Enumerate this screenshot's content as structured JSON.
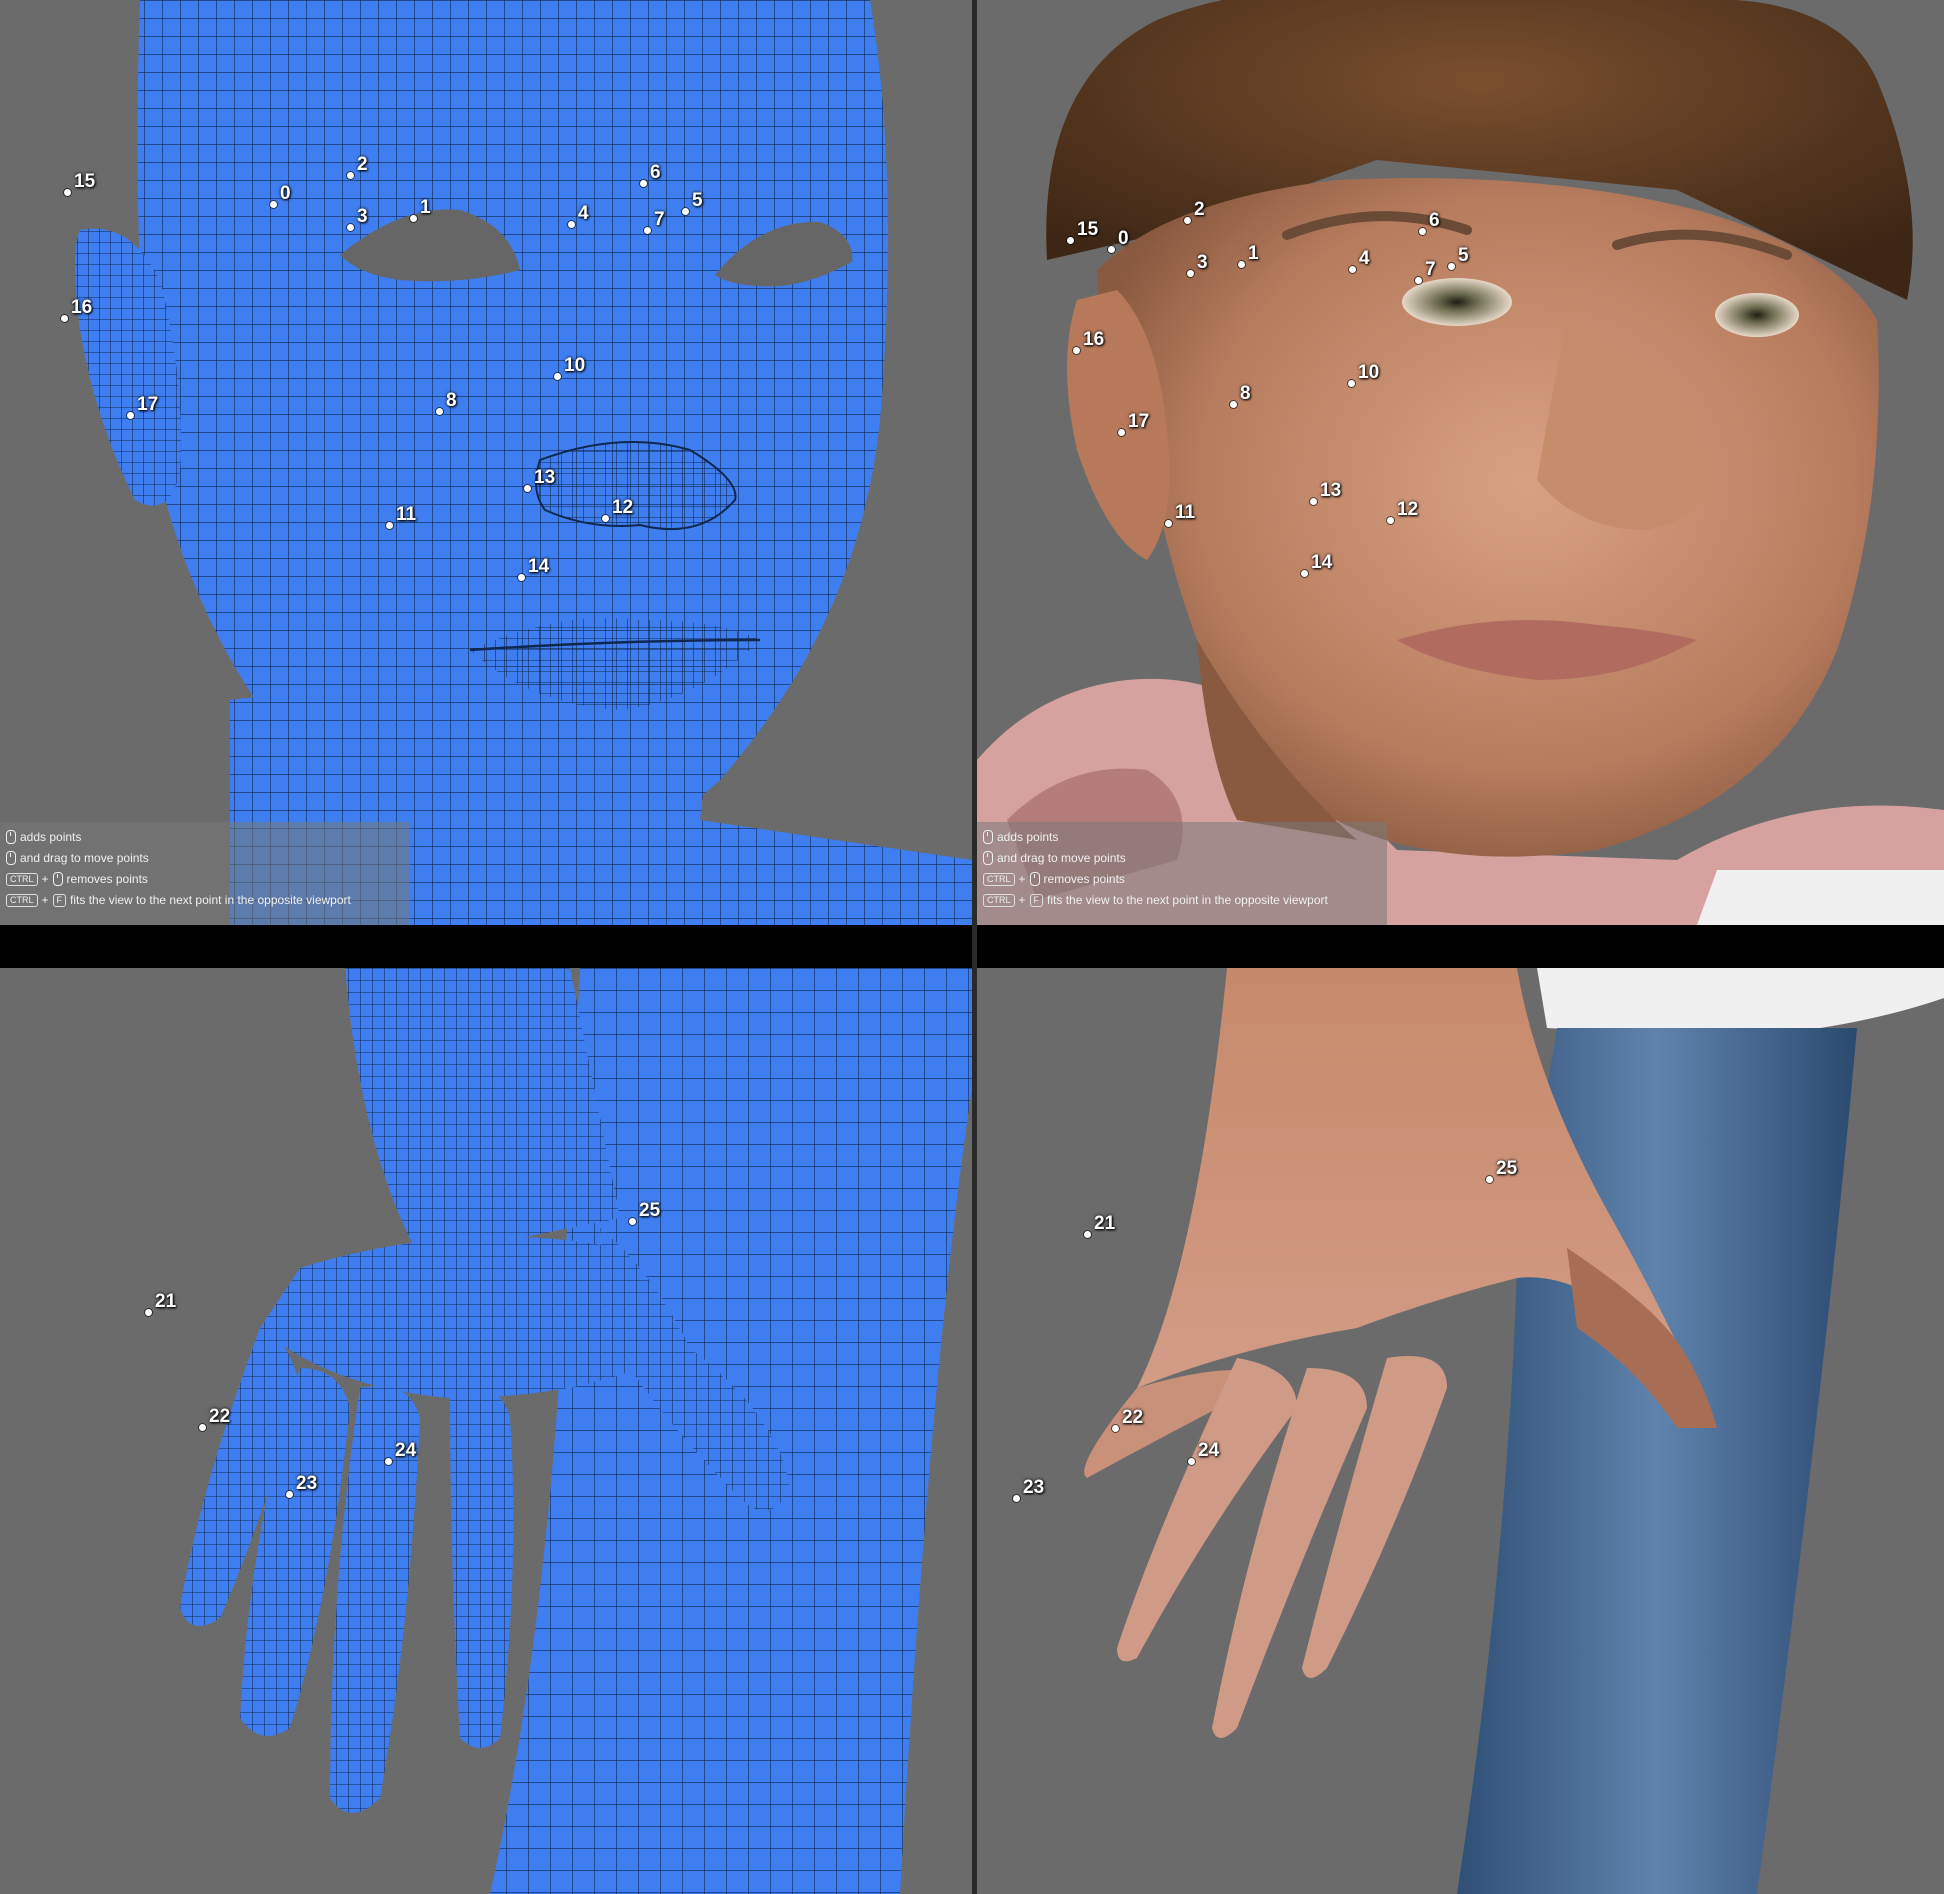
{
  "colors": {
    "background": "#6b6b6b",
    "mesh_fill": "#3f7ef0",
    "mesh_line": "#0f2850",
    "skin": "#c48a68",
    "marker": "#ffffff"
  },
  "viewports": {
    "top_left": {
      "kind": "mesh-face",
      "points": [
        "0",
        "1",
        "2",
        "3",
        "4",
        "5",
        "6",
        "7",
        "8",
        "10",
        "11",
        "12",
        "13",
        "14",
        "15",
        "16",
        "17"
      ]
    },
    "top_right": {
      "kind": "scan-face",
      "points": [
        "0",
        "1",
        "2",
        "3",
        "4",
        "5",
        "6",
        "7",
        "8",
        "10",
        "11",
        "12",
        "13",
        "14",
        "15",
        "16",
        "17"
      ]
    },
    "bottom_left": {
      "kind": "mesh-hand",
      "points": [
        "21",
        "22",
        "23",
        "24",
        "25"
      ]
    },
    "bottom_right": {
      "kind": "scan-hand",
      "points": [
        "21",
        "22",
        "23",
        "24",
        "25"
      ]
    }
  },
  "help": {
    "add": "adds points",
    "drag": "and drag to move points",
    "ctrl_key": "CTRL",
    "f_key": "F",
    "plus": "+",
    "remove": "removes points",
    "fit": "fits the view to the next point in the opposite viewport"
  }
}
